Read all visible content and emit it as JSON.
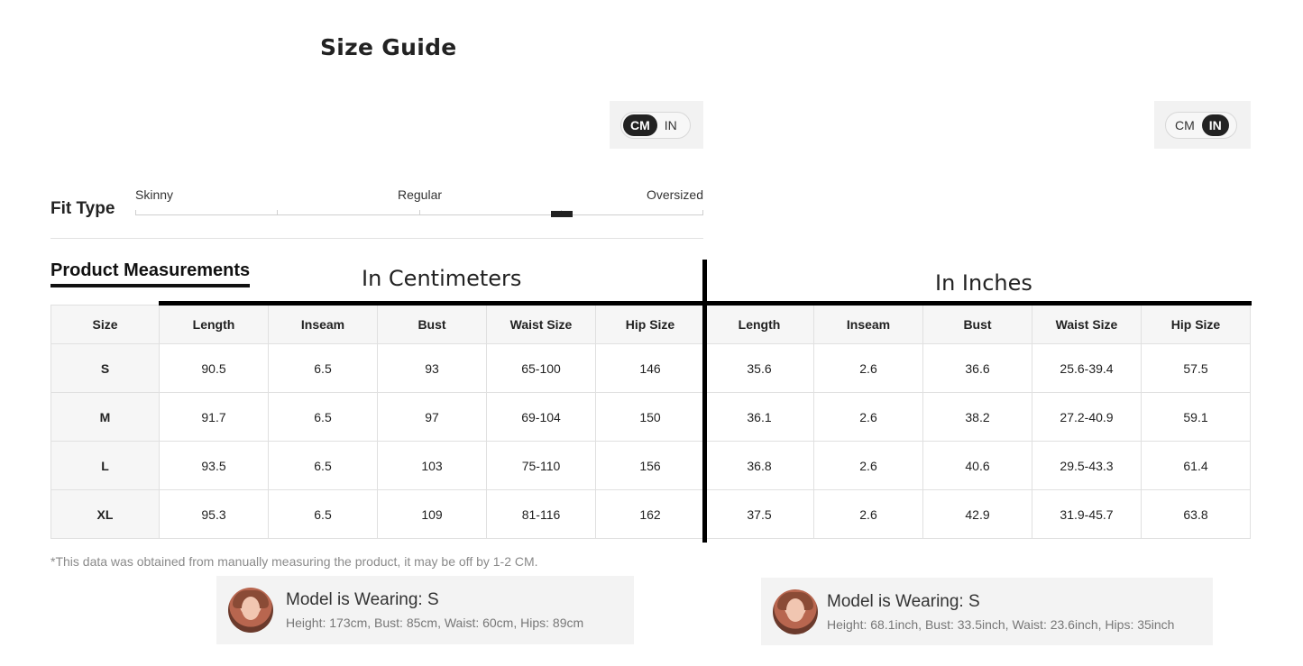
{
  "title": "Size Guide",
  "unit_toggle_cm": {
    "cm": "CM",
    "in": "IN",
    "active": "CM"
  },
  "unit_toggle_in": {
    "cm": "CM",
    "in": "IN",
    "active": "IN"
  },
  "fit": {
    "label": "Fit Type",
    "scale": [
      "Skinny",
      "Regular",
      "Oversized"
    ],
    "level": 0.75
  },
  "measurements": {
    "title": "Product Measurements",
    "group_cm": "In Centimeters",
    "group_in": "In Inches",
    "headers": [
      "Size",
      "Length",
      "Inseam",
      "Bust",
      "Waist Size",
      "Hip Size",
      "Length",
      "Inseam",
      "Bust",
      "Waist Size",
      "Hip Size"
    ],
    "rows": [
      [
        "S",
        "90.5",
        "6.5",
        "93",
        "65-100",
        "146",
        "35.6",
        "2.6",
        "36.6",
        "25.6-39.4",
        "57.5"
      ],
      [
        "M",
        "91.7",
        "6.5",
        "97",
        "69-104",
        "150",
        "36.1",
        "2.6",
        "38.2",
        "27.2-40.9",
        "59.1"
      ],
      [
        "L",
        "93.5",
        "6.5",
        "103",
        "75-110",
        "156",
        "36.8",
        "2.6",
        "40.6",
        "29.5-43.3",
        "61.4"
      ],
      [
        "XL",
        "95.3",
        "6.5",
        "109",
        "81-116",
        "162",
        "37.5",
        "2.6",
        "42.9",
        "31.9-45.7",
        "63.8"
      ]
    ],
    "note": "*This data was obtained from manually measuring the product, it may be off by 1-2 CM."
  },
  "model_cm": {
    "name": "Model is Wearing: S",
    "stats": "Height: 173cm,  Bust: 85cm,  Waist: 60cm,  Hips: 89cm"
  },
  "model_in": {
    "name": "Model is Wearing: S",
    "stats": "Height: 68.1inch,  Bust: 33.5inch,  Waist: 23.6inch,  Hips: 35inch"
  }
}
